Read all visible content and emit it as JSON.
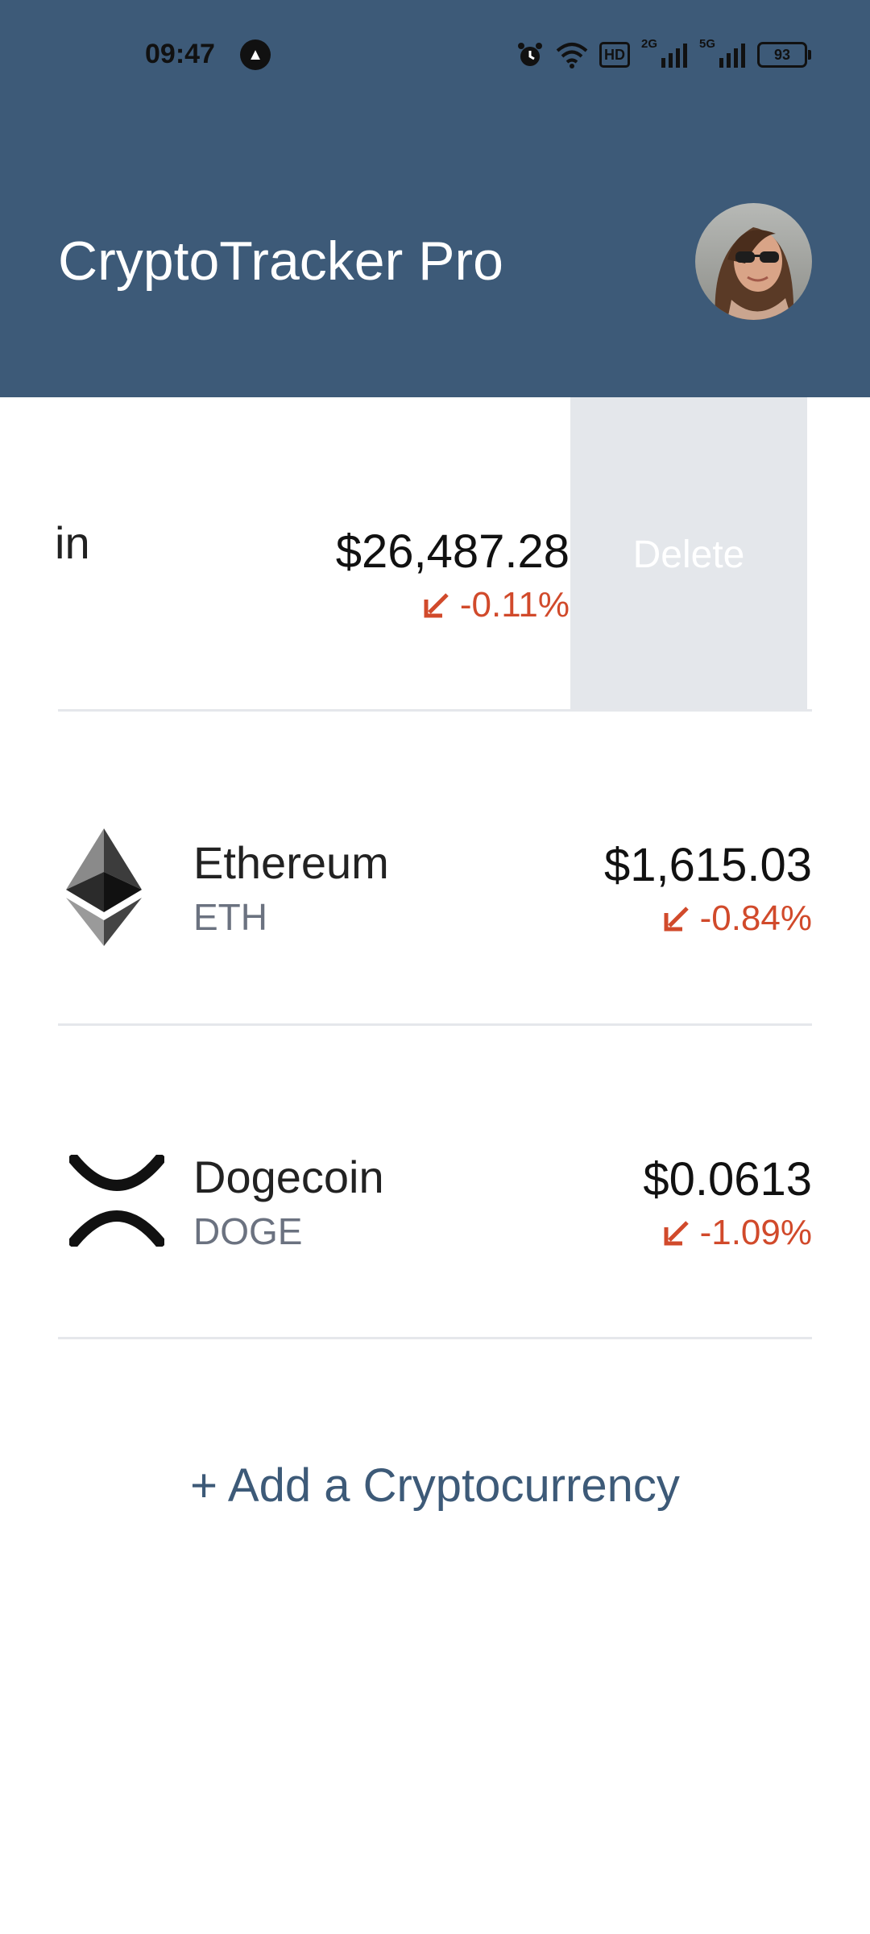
{
  "status_bar": {
    "time": "09:47",
    "hd_label": "HD",
    "network_1": "2G",
    "network_2": "5G",
    "battery": "93"
  },
  "header": {
    "title": "CryptoTracker Pro"
  },
  "coins": [
    {
      "name_visible": "in",
      "price": "$26,487.28",
      "change": "-0.11%",
      "delete_label": "Delete"
    },
    {
      "name": "Ethereum",
      "symbol": "ETH",
      "price": "$1,615.03",
      "change": "-0.84%",
      "icon": "ethereum-icon"
    },
    {
      "name": "Dogecoin",
      "symbol": "DOGE",
      "price": "$0.0613",
      "change": "-1.09%",
      "icon": "xrp-style-icon"
    }
  ],
  "add_link": "+ Add a Cryptocurrency",
  "colors": {
    "header_bg": "#3d5a78",
    "negative": "#d14a2b",
    "delete_bg": "#e4e7eb",
    "link": "#3d5a78"
  }
}
